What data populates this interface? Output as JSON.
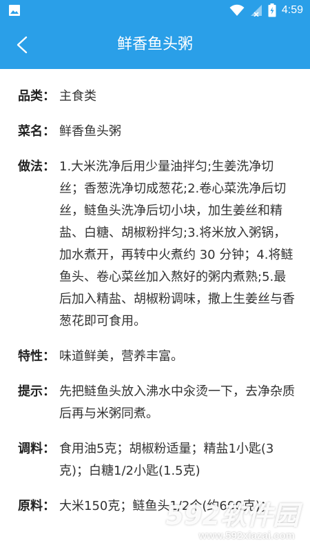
{
  "status_bar": {
    "time": "4:59",
    "icons": [
      "image-icon",
      "wifi-icon",
      "signal-icon",
      "battery-icon"
    ]
  },
  "app_bar": {
    "title": "鲜香鱼头粥",
    "back_icon": "chevron-left-icon"
  },
  "colors": {
    "accent": "#2a9fe8",
    "text": "#333333"
  },
  "details": [
    {
      "label": "品类：",
      "value": "主食类"
    },
    {
      "label": "菜名：",
      "value": "鲜香鱼头粥"
    },
    {
      "label": "做法：",
      "value": "1.大米洗净后用少量油拌匀;生姜洗净切丝；香葱洗净切成葱花;2.卷心菜洗净后切丝，鲢鱼头洗净后切小块，加生姜丝和精盐、白糖、胡椒粉拌匀;3.将米放入粥锅，加水煮开，再转中火煮约 30 分钟；4.将鲢鱼头、卷心菜丝加入熬好的粥内煮熟;5.最后加入精盐、胡椒粉调味，撒上生姜丝与香葱花即可食用。"
    },
    {
      "label": "特性：",
      "value": "味道鲜美，营养丰富。"
    },
    {
      "label": "提示：",
      "value": "先把鲢鱼头放入沸水中汆烫一下，去净杂质后再与米粥同煮。"
    },
    {
      "label": "调料：",
      "value": "食用油5克；胡椒粉适量；精盐1小匙(3克)；白糖1/2小匙(1.5克)"
    },
    {
      "label": "原料：",
      "value": "大米150克；鲢鱼头1/2个(约600克)；"
    }
  ],
  "watermark": {
    "big": "592软件园",
    "small": "www.592xiazai.com"
  }
}
